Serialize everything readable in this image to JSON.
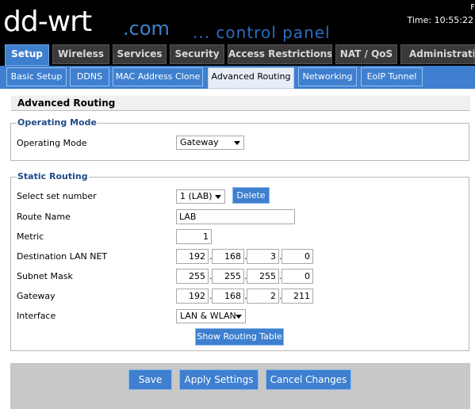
{
  "header": {
    "logo_main": "dd-wrt",
    "logo_com": ".com",
    "logo_panel": "... control panel",
    "corner": "F",
    "time": "Time: 10:55:22"
  },
  "main_tabs": [
    {
      "label": "Setup"
    },
    {
      "label": "Wireless"
    },
    {
      "label": "Services"
    },
    {
      "label": "Security"
    },
    {
      "label": "Access Restrictions"
    },
    {
      "label": "NAT / QoS"
    },
    {
      "label": "Administration"
    }
  ],
  "sub_tabs": [
    {
      "label": "Basic Setup"
    },
    {
      "label": "DDNS"
    },
    {
      "label": "MAC Address Clone"
    },
    {
      "label": "Advanced Routing"
    },
    {
      "label": "Networking"
    },
    {
      "label": "EoIP Tunnel"
    }
  ],
  "page_title": "Advanced Routing",
  "operating_mode": {
    "legend": "Operating Mode",
    "label": "Operating Mode",
    "value": "Gateway"
  },
  "static_routing": {
    "legend": "Static Routing",
    "labels": {
      "set_number": "Select set number",
      "route_name": "Route Name",
      "metric": "Metric",
      "dest_lan": "Destination LAN NET",
      "subnet": "Subnet Mask",
      "gateway": "Gateway",
      "interface": "Interface"
    },
    "set_number_value": "1 (LAB)",
    "delete_label": "Delete",
    "route_name_value": "LAB",
    "metric_value": "1",
    "dest_lan": [
      "192",
      "168",
      "3",
      "0"
    ],
    "subnet": [
      "255",
      "255",
      "255",
      "0"
    ],
    "gateway": [
      "192",
      "168",
      "2",
      "211"
    ],
    "interface_value": "LAN & WLAN",
    "show_table_label": "Show Routing Table"
  },
  "footer": {
    "save": "Save",
    "apply": "Apply Settings",
    "cancel": "Cancel Changes"
  },
  "colors": {
    "accent": "#3e7fcf",
    "legend": "#1f4c8a",
    "header_bg": "#000000"
  }
}
